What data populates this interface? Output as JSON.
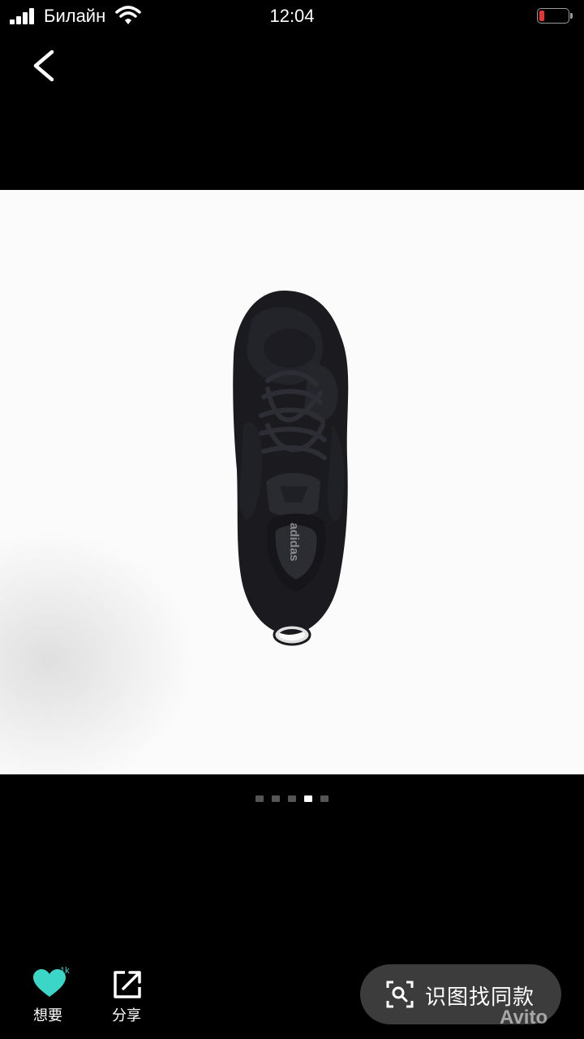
{
  "status": {
    "carrier": "Билайн",
    "time": "12:04"
  },
  "gallery": {
    "image": "black-sneaker-top-view",
    "brand_text": "adidas",
    "page_count": 5,
    "active_page": 4
  },
  "actions": {
    "want_label": "想要",
    "want_count": "1k",
    "share_label": "分享",
    "find_similar_label": "识图找同款"
  },
  "watermark": "Avito",
  "colors": {
    "accent": "#3cd6c8",
    "background": "#000000",
    "pill": "#3c3c3c"
  }
}
